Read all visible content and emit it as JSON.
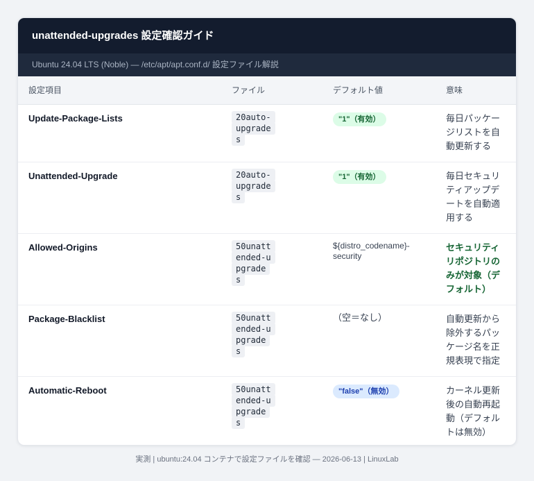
{
  "header": {
    "title": "unattended-upgrades 設定確認ガイド",
    "subtitle": "Ubuntu 24.04 LTS (Noble) — /etc/apt/apt.conf.d/ 設定ファイル解説"
  },
  "table": {
    "columns": [
      "設定項目",
      "ファイル",
      "デフォルト値",
      "意味"
    ],
    "rows": [
      {
        "key": "Update-Package-Lists",
        "file": "20auto-upgrades",
        "default": "\"1\"（有効）",
        "default_style": "green",
        "meaning": "毎日パッケージリストを自動更新する"
      },
      {
        "key": "Unattended-Upgrade",
        "file": "20auto-upgrades",
        "default": "\"1\"（有効）",
        "default_style": "green",
        "meaning": "毎日セキュリティアップデートを自動適用する"
      },
      {
        "key": "Allowed-Origins",
        "file": "50unattended-upgrades",
        "default": "${distro_codename}-security",
        "default_style": "plain",
        "meaning": "セキュリティリポジトリのみが対象（デフォルト）",
        "meaning_style": "strong"
      },
      {
        "key": "Package-Blacklist",
        "file": "50unattended-upgrades",
        "default": "（空＝なし）",
        "default_style": "plain",
        "meaning": "自動更新から除外するパッケージ名を正規表現で指定"
      },
      {
        "key": "Automatic-Reboot",
        "file": "50unattended-upgrades",
        "default": "\"false\"（無効）",
        "default_style": "blue",
        "meaning": "カーネル更新後の自動再起動（デフォルトは無効）"
      }
    ]
  },
  "footer": {
    "text": "実測 | ubuntu:24.04 コンテナで設定ファイルを確認 — 2026-06-13 | LinuxLab"
  },
  "colors": {
    "header_bg": "#131c2e",
    "subheader_bg": "#1f2a3d",
    "green_badge_bg": "#dcfce7",
    "green_text": "#166534",
    "blue_badge_bg": "#dbeafe",
    "blue_text": "#1e40af"
  }
}
